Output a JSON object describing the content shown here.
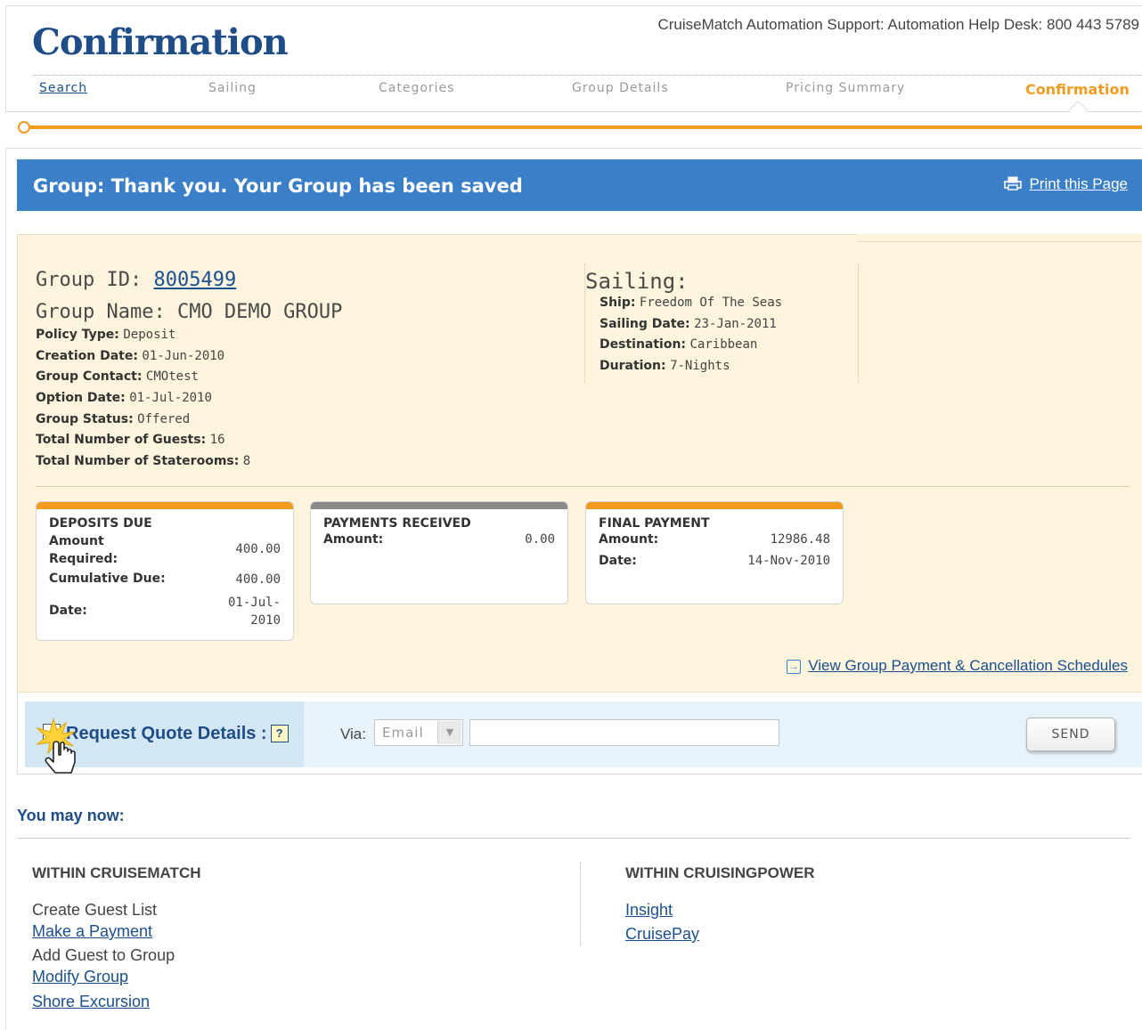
{
  "header": {
    "title": "Confirmation",
    "support": "CruiseMatch Automation Support: Automation Help Desk: 800 443 5789"
  },
  "steps": [
    {
      "label": "Search"
    },
    {
      "label": "Sailing"
    },
    {
      "label": "Categories"
    },
    {
      "label": "Group Details"
    },
    {
      "label": "Pricing Summary"
    },
    {
      "label": "Confirmation"
    }
  ],
  "banner": {
    "title": "Group: Thank you. Your Group has been saved",
    "print_label": "Print this Page"
  },
  "group": {
    "id_label": "Group ID:",
    "id_value": "8005499",
    "name_label": "Group Name:",
    "name_value": "CMO DEMO GROUP",
    "details": [
      {
        "label": "Policy Type:",
        "value": "Deposit"
      },
      {
        "label": "Creation Date:",
        "value": "01-Jun-2010"
      },
      {
        "label": "Group Contact:",
        "value": "CMOtest"
      },
      {
        "label": "Option Date:",
        "value": "01-Jul-2010"
      },
      {
        "label": "Group Status:",
        "value": "Offered"
      },
      {
        "label": "Total Number of Guests:",
        "value": "16"
      },
      {
        "label": "Total Number of Staterooms:",
        "value": "8"
      }
    ]
  },
  "sailing": {
    "title": "Sailing:",
    "details": [
      {
        "label": "Ship:",
        "value": "Freedom Of The Seas"
      },
      {
        "label": "Sailing Date:",
        "value": "23-Jan-2011"
      },
      {
        "label": "Destination:",
        "value": "Caribbean"
      },
      {
        "label": "Duration:",
        "value": "7-Nights"
      }
    ]
  },
  "deposits": {
    "title": "DEPOSITS DUE",
    "amount_label_1": "Amount",
    "amount_label_2": "Required:",
    "amount_value": "400.00",
    "cumulative_label": "Cumulative Due:",
    "cumulative_value": "400.00",
    "date_label": "Date:",
    "date_value_1": "01-Jul-",
    "date_value_2": "2010"
  },
  "payments": {
    "title": "PAYMENTS RECEIVED",
    "amount_label": "Amount:",
    "amount_value": "0.00"
  },
  "final_payment": {
    "title": "FINAL PAYMENT",
    "amount_label": "Amount:",
    "amount_value": "12986.48",
    "date_label": "Date:",
    "date_value": "14-Nov-2010"
  },
  "schedules_link": "View Group Payment & Cancellation Schedules",
  "quote": {
    "label": "Request Quote Details :",
    "help": "?",
    "via_label": "Via:",
    "via_value": "Email",
    "email_value": "",
    "send_label": "SEND"
  },
  "you_may_now": {
    "title": "You may now:",
    "cruisematch": {
      "heading": "WITHIN CRUISEMATCH",
      "items": [
        {
          "label": "Create Guest List"
        },
        {
          "label": "Make a Payment"
        },
        {
          "label": "Add Guest to Group"
        },
        {
          "label": "Modify Group"
        },
        {
          "label": "Shore Excursion"
        }
      ]
    },
    "cruisingpower": {
      "heading": "WITHIN CRUISINGPOWER",
      "items": [
        {
          "label": "Insight"
        },
        {
          "label": "CruisePay"
        }
      ]
    }
  },
  "colors": {
    "accent_orange": "#f39b1e",
    "banner_blue": "#3a7fc8",
    "title_navy": "#1e4d87",
    "panel_cream": "#fcf4dc"
  }
}
